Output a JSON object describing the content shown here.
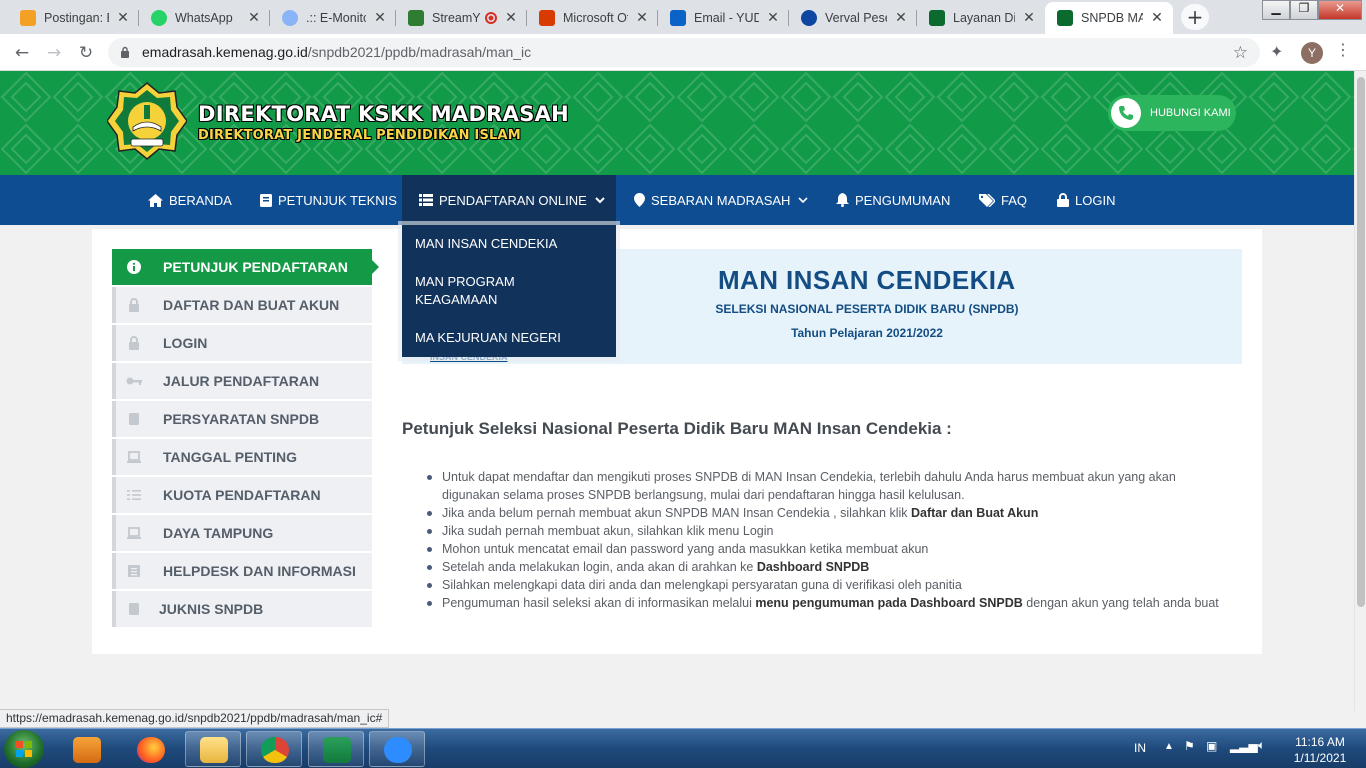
{
  "browser": {
    "tabs": [
      {
        "title": "Postingan: E",
        "color": "#f4a024"
      },
      {
        "title": "WhatsApp",
        "color": "#25d366"
      },
      {
        "title": ".:: E-Monitor",
        "color": "#8ab4f8"
      },
      {
        "title": "StreamY",
        "color": "#2e7d32"
      },
      {
        "title": "Microsoft Of",
        "color": "#d83b01"
      },
      {
        "title": "Email - YUDI",
        "color": "#0a64c8"
      },
      {
        "title": "Verval Peser",
        "color": "#0d47a1"
      },
      {
        "title": "Layanan Dire",
        "color": "#0b6b2f"
      },
      {
        "title": "SNPDB MAN",
        "color": "#0b6b2f"
      }
    ],
    "url_host": "emadrasah.kemenag.go.id",
    "url_path": "/snpdb2021/ppdb/madrasah/man_ic",
    "profile_initial": "Y",
    "status_url": "https://emadrasah.kemenag.go.id/snpdb2021/ppdb/madrasah/man_ic#"
  },
  "header": {
    "brand_title": "DIREKTORAT KSKK MADRASAH",
    "brand_subtitle": "DIREKTORAT JENDERAL PENDIDIKAN ISLAM",
    "contact_label": "HUBUNGI KAMI"
  },
  "nav": {
    "items": [
      {
        "label": "BERANDA",
        "icon": "home-icon"
      },
      {
        "label": "PETUNJUK TEKNIS",
        "icon": "book-icon"
      },
      {
        "label": "PENDAFTARAN ONLINE",
        "icon": "list-icon"
      },
      {
        "label": "SEBARAN MADRASAH",
        "icon": "map-marker-icon"
      },
      {
        "label": "PENGUMUMAN",
        "icon": "bell-icon"
      },
      {
        "label": "FAQ",
        "icon": "tags-icon"
      },
      {
        "label": "LOGIN",
        "icon": "lock-icon"
      }
    ],
    "dropdown": [
      "MAN INSAN CENDEKIA",
      "MAN PROGRAM KEAGAMAAN",
      "MA KEJURUAN NEGERI"
    ]
  },
  "sidebar": {
    "items": [
      {
        "label": "PETUNJUK PENDAFTARAN",
        "icon": "info-icon"
      },
      {
        "label": "DAFTAR DAN BUAT AKUN",
        "icon": "lock-icon"
      },
      {
        "label": "LOGIN",
        "icon": "lock-icon"
      },
      {
        "label": "JALUR PENDAFTARAN",
        "icon": "key-icon"
      },
      {
        "label": "PERSYARATAN SNPDB",
        "icon": "book-icon"
      },
      {
        "label": "TANGGAL PENTING",
        "icon": "laptop-icon"
      },
      {
        "label": "KUOTA PENDAFTARAN",
        "icon": "list-icon"
      },
      {
        "label": "DAYA TAMPUNG",
        "icon": "laptop-icon"
      },
      {
        "label": "HELPDESK DAN INFORMASI",
        "icon": "list-icon"
      },
      {
        "label": "JUKNIS SNPDB",
        "icon": "book-icon"
      }
    ]
  },
  "hero": {
    "title": "MAN INSAN CENDEKIA",
    "subtitle": "SELEKSI NASIONAL PESERTA DIDIK BARU (SNPDB)",
    "year": "Tahun Pelajaran 2021/2022",
    "small_label": "INSAN CENDEKIA"
  },
  "content": {
    "heading": "Petunjuk Seleksi Nasional Peserta Didik Baru MAN Insan Cendekia :",
    "b1": "Untuk dapat mendaftar dan mengikuti proses SNPDB di MAN Insan Cendekia, terlebih dahulu Anda harus membuat akun yang akan digunakan selama proses SNPDB berlangsung, mulai dari pendaftaran hingga hasil kelulusan.",
    "b2_pre": "Jika anda belum pernah membuat akun SNPDB MAN Insan Cendekia , silahkan klik ",
    "b2_bold": "Daftar dan Buat Akun",
    "b3": "Jika sudah pernah membuat akun, silahkan klik menu Login",
    "b4": "Mohon untuk mencatat email dan password yang anda masukkan ketika membuat akun",
    "b5_pre": "Setelah anda melakukan login, anda akan di arahkan ke ",
    "b5_bold": "Dashboard SNPDB",
    "b6": "Silahkan melengkapi data diri anda dan melengkapi persyaratan guna di verifikasi oleh panitia",
    "b7_pre": "Pengumuman hasil seleksi akan di informasikan melalui ",
    "b7_bold": "menu pengumuman pada Dashboard SNPDB",
    "b7_post": " dengan akun yang telah anda buat"
  },
  "taskbar": {
    "lang": "IN",
    "time": "11:16 AM",
    "date": "1/11/2021"
  }
}
